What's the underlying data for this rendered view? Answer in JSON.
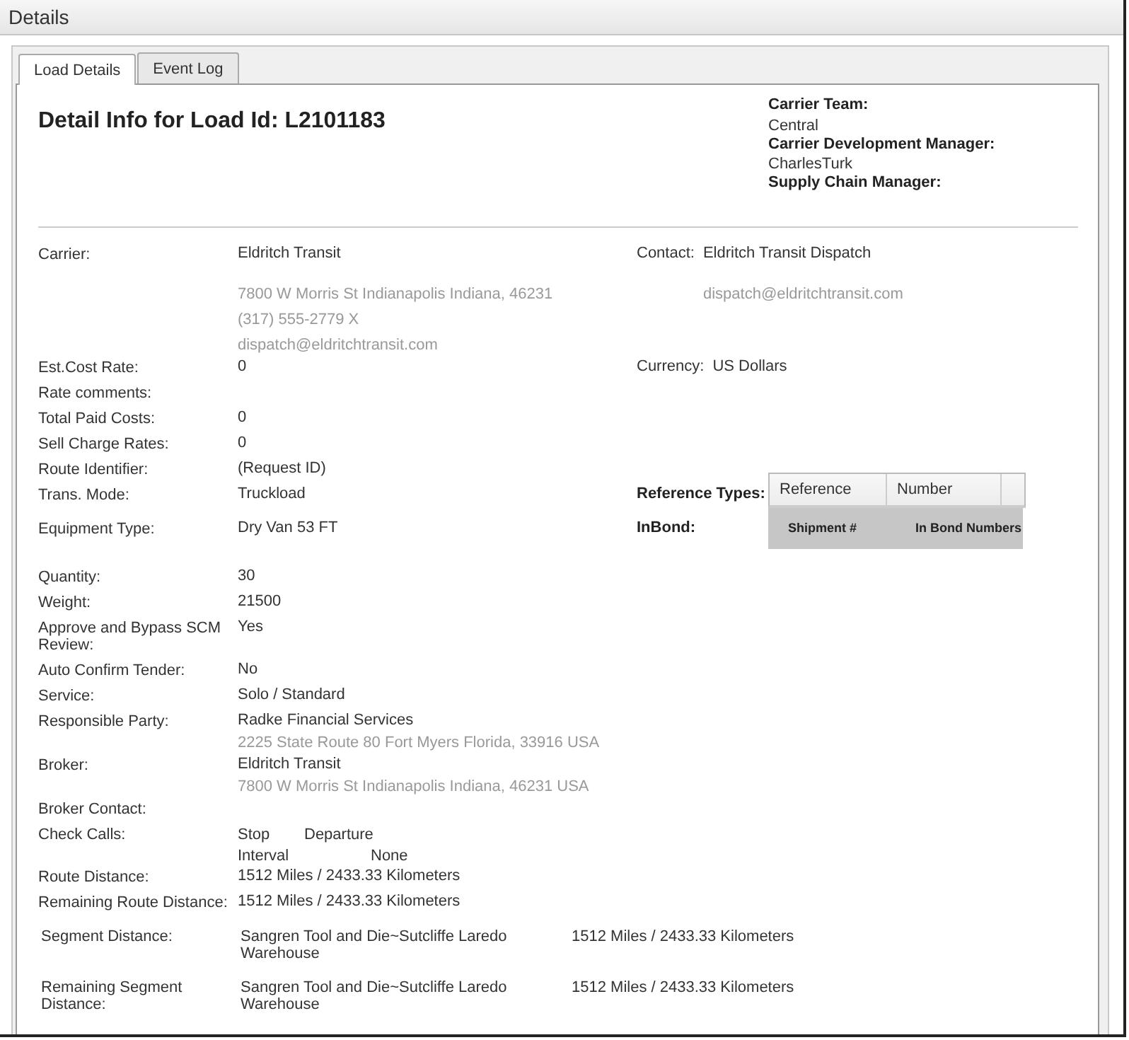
{
  "window": {
    "title": "Details"
  },
  "tabs": [
    {
      "label": "Load Details",
      "selected": true
    },
    {
      "label": "Event Log",
      "selected": false
    }
  ],
  "heading": "Detail Info for Load Id: L2101183",
  "managers": [
    {
      "label": "Carrier Team:",
      "value": "Central"
    },
    {
      "label": "Carrier Development Manager:",
      "value": "CharlesTurk"
    },
    {
      "label": "Supply Chain Manager:"
    }
  ],
  "fields": [
    {
      "kind": "contact",
      "label": "Carrier:",
      "value": "Eldritch Transit",
      "details": [
        "7800 W Morris St Indianapolis Indiana, 46231",
        "(317) 555-2779 X",
        "dispatch@eldritchtransit.com"
      ],
      "side": {
        "kind": "text",
        "label": "Contact:",
        "value": "Eldritch Transit Dispatch",
        "details": [
          "dispatch@eldritchtransit.com"
        ]
      }
    },
    {
      "kind": "field",
      "label": "Est.Cost Rate:",
      "value": "0",
      "side": {
        "kind": "text",
        "label": "Currency:",
        "value": "US Dollars"
      }
    },
    {
      "kind": "field",
      "label": "Rate comments:"
    },
    {
      "kind": "field",
      "label": "Total Paid Costs:",
      "value": "0"
    },
    {
      "kind": "field",
      "label": "Sell Charge Rates:",
      "value": "0"
    },
    {
      "kind": "field",
      "label": "Route Identifier:",
      "value": "(Request ID)"
    },
    {
      "kind": "field",
      "label": "Trans. Mode:",
      "value": "Truckload",
      "side": {
        "kind": "bordered_table",
        "label": "Reference Types:",
        "columns": [
          "Reference",
          "Number"
        ]
      }
    },
    {
      "kind": "field",
      "label": "Equipment Type:",
      "value": "Dry Van 53 FT",
      "side": {
        "kind": "shaded_table",
        "label": "InBond:",
        "columns": [
          "Shipment #",
          "In Bond Numbers"
        ]
      }
    },
    {
      "kind": "field",
      "label": "Quantity:",
      "value": "30"
    },
    {
      "kind": "field",
      "label": "Weight:",
      "value": "21500"
    },
    {
      "kind": "field",
      "label": "Approve and Bypass SCM Review:",
      "value": "Yes"
    },
    {
      "kind": "field",
      "label": "Auto Confirm Tender:",
      "value": "No"
    },
    {
      "kind": "field",
      "label": "Service:",
      "value": "Solo / Standard"
    },
    {
      "kind": "field",
      "label": "Responsible Party:",
      "value": "Radke Financial Services",
      "details": [
        "2225 State Route 80 Fort Myers Florida, 33916 USA"
      ]
    },
    {
      "kind": "field",
      "label": "Broker:",
      "value": "Eldritch Transit",
      "details": [
        "7800 W Morris St Indianapolis Indiana, 46231 USA"
      ]
    },
    {
      "kind": "field",
      "label": "Broker Contact:"
    },
    {
      "kind": "pairs",
      "label": "Check Calls:",
      "pairs": [
        [
          "Stop",
          "Departure"
        ],
        [
          "Interval",
          "None"
        ]
      ]
    },
    {
      "kind": "field",
      "label": "Route Distance:",
      "value": "1512 Miles / 2433.33 Kilometers"
    },
    {
      "kind": "field",
      "label": "Remaining Route Distance:",
      "value": "1512 Miles / 2433.33 Kilometers"
    },
    {
      "kind": "segment",
      "label": "Segment Distance:",
      "value": "Sangren Tool and Die~Sutcliffe Laredo Warehouse",
      "extra": "1512 Miles / 2433.33 Kilometers"
    },
    {
      "kind": "segment",
      "label": "Remaining Segment Distance:",
      "value": "Sangren Tool and Die~Sutcliffe Laredo Warehouse",
      "extra": "1512 Miles / 2433.33 Kilometers"
    }
  ]
}
